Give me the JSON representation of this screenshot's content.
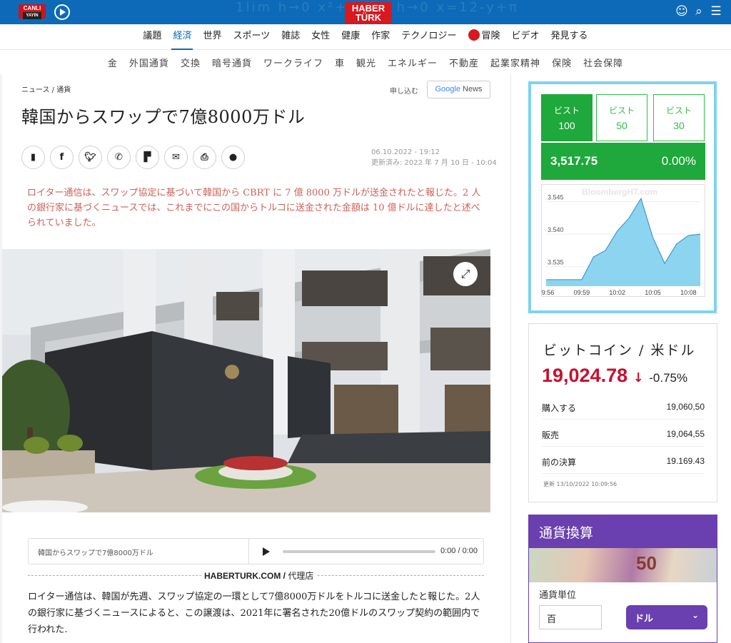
{
  "header": {
    "live_label": "CANLI",
    "live_sub": "YAYIN",
    "logo_line1": "HABER",
    "logo_line2": "TÜRK",
    "bg_math": "1lim h→0   x²+5   lim h→0   x=12-y+π"
  },
  "nav_main": [
    "議題",
    "経済",
    "世界",
    "スポーツ",
    "雑誌",
    "女性",
    "健康",
    "作家",
    "テクノロジー",
    "冒険",
    "ビデオ",
    "発見する"
  ],
  "nav_sub": [
    "金",
    "外国通貨",
    "交換",
    "暗号通貨",
    "ワークライフ",
    "車",
    "観光",
    "エネルギー",
    "不動産",
    "起業家精神",
    "保険",
    "社会保障"
  ],
  "article": {
    "breadcrumb": "ニュース / 通貨",
    "gn_label": "申し込む",
    "gn_google": "Google",
    "gn_news": " News",
    "title": "韓国からスワップで7億8000万ドル",
    "date": "06.10.2022 - 19:12",
    "updated": "更新済み: 2022 年 7 月 10 日 - 10:04",
    "summary": "ロイター通信は、スワップ協定に基づいて韓国から CBRT に 7 億 8000 万ドルが送金されたと報じた。2 人の銀行家に基づくニュースでは、これまでにこの国からトルコに送金された金額は 10 億ドルに達したと述べられていました。",
    "audio_title": "韓国からスワップで7億8000万ドル",
    "audio_time": "0:00 / 0:00",
    "agency_name": "HABERTURK.COM",
    "agency_sep": " / ",
    "agency_role": "代理店",
    "body": "ロイター通信は、韓国が先週、スワップ協定の一環として7億8000万ドルをトルコに送金したと報じた。2人の銀行家に基づくニュースによると、この譲渡は、2021年に署名された20億ドルのスワップ契約の範囲内で行われた."
  },
  "share_icons": [
    "bookmark-icon",
    "facebook-icon",
    "twitter-icon",
    "whatsapp-icon",
    "flipboard-icon",
    "mail-icon",
    "print-icon",
    "comment-icon"
  ],
  "bist": {
    "tabs": [
      {
        "label": "ビスト",
        "num": "100"
      },
      {
        "label": "ビスト",
        "num": "50"
      },
      {
        "label": "ビスト",
        "num": "30"
      }
    ],
    "value": "3,517.75",
    "change": "0.00%",
    "watermark": "BloombergHT.com",
    "accent": "#1fa83b"
  },
  "chart_data": {
    "type": "area",
    "title": "",
    "x": [
      "09:56",
      "09:57",
      "09:58",
      "09:59",
      "10:00",
      "10:01",
      "10:02",
      "10:03",
      "10:04",
      "10:05",
      "10:06",
      "10:07",
      "10:08",
      "10:09"
    ],
    "xticks": [
      "09:56",
      "09:59",
      "10:02",
      "10:05",
      "10:08"
    ],
    "values": [
      3.533,
      3.533,
      3.533,
      3.533,
      3.5365,
      3.5375,
      3.5405,
      3.5425,
      3.5455,
      3.5395,
      3.5355,
      3.5385,
      3.5398,
      3.54
    ],
    "yticks": [
      "3.545",
      "3.540",
      "3.535"
    ],
    "ylim": [
      3.532,
      3.5465
    ],
    "fill": "#7fcfee",
    "line": "#2a8cc7"
  },
  "bitcoin": {
    "title": "ビットコイン / 米ドル",
    "price": "19,024.78",
    "change": "-0.75%",
    "rows": [
      {
        "k": "購入する",
        "v": "19,060,50"
      },
      {
        "k": "販売",
        "v": "19,064,55"
      },
      {
        "k": "前の決算",
        "v": "19.169.43"
      }
    ],
    "updated": "更新 13/10/2022 10:09:56"
  },
  "converter": {
    "title": "通貨換算",
    "note": "50",
    "unit_label": "通貨単位",
    "input_value": "百",
    "select_value": "ドル"
  }
}
